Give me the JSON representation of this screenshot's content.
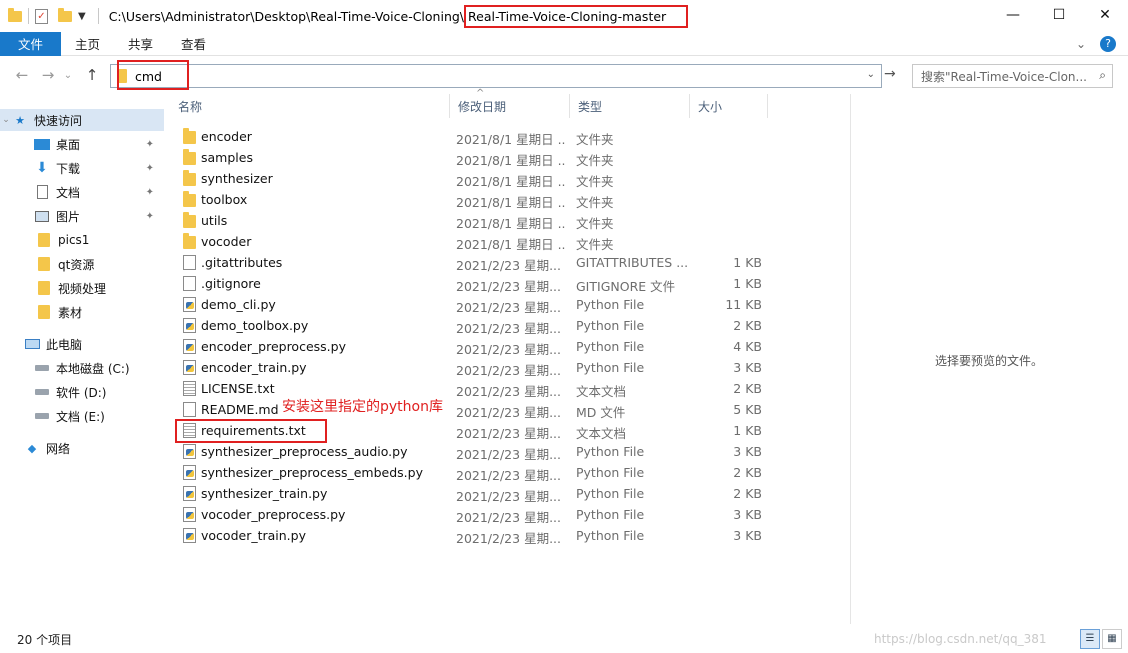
{
  "titlebar": {
    "path_prefix": "C:\\Users\\Administrator\\Desktop\\Real-Time-Voice-Cloning\\",
    "path_current": "Real-Time-Voice-Cloning-master",
    "minimize": "—",
    "maximize": "☐",
    "close": "✕"
  },
  "ribbon": {
    "tabs": [
      "文件",
      "主页",
      "共享",
      "查看"
    ],
    "expand_icon": "⌄",
    "help": "?"
  },
  "address": {
    "back": "←",
    "forward": "→",
    "recent": "⌄",
    "up": "↑",
    "value": "cmd",
    "dropdown": "⌄",
    "go": "→",
    "search_placeholder": "搜索\"Real-Time-Voice-Clon...",
    "search_icon": "⌕"
  },
  "sidebar": {
    "quick_access": "快速访问",
    "items": [
      {
        "label": "桌面",
        "icon": "desktop-icon",
        "pinned": true
      },
      {
        "label": "下载",
        "icon": "download-icon",
        "pinned": true
      },
      {
        "label": "文档",
        "icon": "document-icon",
        "pinned": true
      },
      {
        "label": "图片",
        "icon": "picture-icon",
        "pinned": true
      },
      {
        "label": "pics1",
        "icon": "folder-icon",
        "pinned": false
      },
      {
        "label": "qt资源",
        "icon": "folder-icon",
        "pinned": false
      },
      {
        "label": "视频处理",
        "icon": "folder-icon",
        "pinned": false
      },
      {
        "label": "素材",
        "icon": "folder-icon",
        "pinned": false
      }
    ],
    "this_pc": "此电脑",
    "drives": [
      {
        "label": "本地磁盘 (C:)"
      },
      {
        "label": "软件 (D:)"
      },
      {
        "label": "文档 (E:)"
      }
    ],
    "network": "网络"
  },
  "columns": {
    "name": "名称",
    "date": "修改日期",
    "type": "类型",
    "size": "大小",
    "sort_indicator": "^"
  },
  "files": [
    {
      "name": "encoder",
      "date": "2021/8/1 星期日 ...",
      "type": "文件夹",
      "size": "",
      "kind": "folder"
    },
    {
      "name": "samples",
      "date": "2021/8/1 星期日 ...",
      "type": "文件夹",
      "size": "",
      "kind": "folder"
    },
    {
      "name": "synthesizer",
      "date": "2021/8/1 星期日 ...",
      "type": "文件夹",
      "size": "",
      "kind": "folder"
    },
    {
      "name": "toolbox",
      "date": "2021/8/1 星期日 ...",
      "type": "文件夹",
      "size": "",
      "kind": "folder"
    },
    {
      "name": "utils",
      "date": "2021/8/1 星期日 ...",
      "type": "文件夹",
      "size": "",
      "kind": "folder"
    },
    {
      "name": "vocoder",
      "date": "2021/8/1 星期日 ...",
      "type": "文件夹",
      "size": "",
      "kind": "folder"
    },
    {
      "name": ".gitattributes",
      "date": "2021/2/23 星期...",
      "type": "GITATTRIBUTES ...",
      "size": "1 KB",
      "kind": "doc"
    },
    {
      "name": ".gitignore",
      "date": "2021/2/23 星期...",
      "type": "GITIGNORE 文件",
      "size": "1 KB",
      "kind": "doc"
    },
    {
      "name": "demo_cli.py",
      "date": "2021/2/23 星期...",
      "type": "Python File",
      "size": "11 KB",
      "kind": "py"
    },
    {
      "name": "demo_toolbox.py",
      "date": "2021/2/23 星期...",
      "type": "Python File",
      "size": "2 KB",
      "kind": "py"
    },
    {
      "name": "encoder_preprocess.py",
      "date": "2021/2/23 星期...",
      "type": "Python File",
      "size": "4 KB",
      "kind": "py"
    },
    {
      "name": "encoder_train.py",
      "date": "2021/2/23 星期...",
      "type": "Python File",
      "size": "3 KB",
      "kind": "py"
    },
    {
      "name": "LICENSE.txt",
      "date": "2021/2/23 星期...",
      "type": "文本文档",
      "size": "2 KB",
      "kind": "txt"
    },
    {
      "name": "README.md",
      "date": "2021/2/23 星期...",
      "type": "MD 文件",
      "size": "5 KB",
      "kind": "doc"
    },
    {
      "name": "requirements.txt",
      "date": "2021/2/23 星期...",
      "type": "文本文档",
      "size": "1 KB",
      "kind": "txt"
    },
    {
      "name": "synthesizer_preprocess_audio.py",
      "date": "2021/2/23 星期...",
      "type": "Python File",
      "size": "3 KB",
      "kind": "py"
    },
    {
      "name": "synthesizer_preprocess_embeds.py",
      "date": "2021/2/23 星期...",
      "type": "Python File",
      "size": "2 KB",
      "kind": "py"
    },
    {
      "name": "synthesizer_train.py",
      "date": "2021/2/23 星期...",
      "type": "Python File",
      "size": "2 KB",
      "kind": "py"
    },
    {
      "name": "vocoder_preprocess.py",
      "date": "2021/2/23 星期...",
      "type": "Python File",
      "size": "3 KB",
      "kind": "py"
    },
    {
      "name": "vocoder_train.py",
      "date": "2021/2/23 星期...",
      "type": "Python File",
      "size": "3 KB",
      "kind": "py"
    }
  ],
  "annotation": "安装这里指定的python库",
  "preview": {
    "message": "选择要预览的文件。"
  },
  "status": {
    "item_count": "20 个项目",
    "watermark": "https://blog.csdn.net/qq_381"
  },
  "colors": {
    "accent": "#1979ca",
    "highlight_red": "#e02020",
    "folder": "#f4c64a",
    "selection": "#d9e6f4"
  }
}
